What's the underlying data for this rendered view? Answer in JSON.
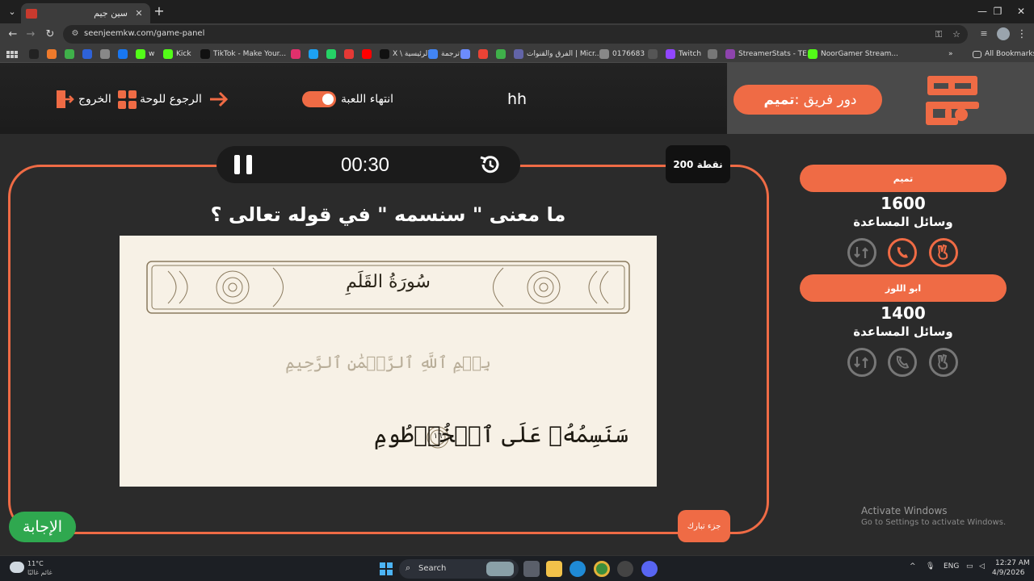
{
  "browser": {
    "tab_title": "سين جيم",
    "tab_close": "✕",
    "new_tab": "+",
    "url": "seenjeemkw.com/game-panel",
    "window_controls": [
      "—",
      "❐",
      "✕"
    ],
    "bookmarks": [
      {
        "label": "",
        "color": "#222"
      },
      {
        "label": "",
        "color": "#ef7a2b"
      },
      {
        "label": "",
        "color": "#3fb04a"
      },
      {
        "label": "",
        "color": "#2e62d8"
      },
      {
        "label": "",
        "color": "#888"
      },
      {
        "label": "",
        "color": "#1877f2"
      },
      {
        "label": "w",
        "color": "#53fc18"
      },
      {
        "label": "Kick",
        "color": "#53fc18"
      },
      {
        "label": "TikTok - Make Your...",
        "color": "#111"
      },
      {
        "label": "",
        "color": "#e1306c"
      },
      {
        "label": "",
        "color": "#1da1f2"
      },
      {
        "label": "",
        "color": "#25d366"
      },
      {
        "label": "",
        "color": "#e53935"
      },
      {
        "label": "",
        "color": "#ff0000"
      },
      {
        "label": "X \\ الرئيسية",
        "color": "#111"
      },
      {
        "label": "ترجمة",
        "color": "#4285f4"
      },
      {
        "label": "",
        "color": "#6c8cff"
      },
      {
        "label": "",
        "color": "#ea4335"
      },
      {
        "label": "",
        "color": "#3fb04a"
      },
      {
        "label": "الفرق والقنوات | Micr...",
        "color": "#6264a7"
      },
      {
        "label": "0176683",
        "color": "#888"
      },
      {
        "label": "",
        "color": "#555"
      },
      {
        "label": "Twitch",
        "color": "#9146ff"
      },
      {
        "label": "",
        "color": "#777"
      },
      {
        "label": "StreamerStats - TE...",
        "color": "#8e44ad"
      },
      {
        "label": "NoorGamer Stream...",
        "color": "#53fc18"
      }
    ],
    "all_bookmarks": "All Bookmarks",
    "chevron": "»"
  },
  "header": {
    "turn_label": "دور فريق :",
    "turn_team": "تميم",
    "game_name": "hh",
    "end_game": "انتهاء اللعبة",
    "back_to_board": "الرجوع للوحة",
    "exit": "الخروج"
  },
  "board": {
    "timer": "00:30",
    "points": "200 نقطة",
    "question": "ما معنى \" سنسمه \" في قوله تعالى ؟",
    "surah_title": "سُورَةُ القَلَمِ",
    "basmala": "بِسۡمِ ٱللَّهِ ٱلرَّحۡمَٰنِ ٱلرَّحِيمِ",
    "verse": "سَنَسِمُهُۥ عَلَى ٱلۡخُرۡطُومِ",
    "verse_number": "١٦",
    "category": "جزء تبارك",
    "answer_button": "الإجابة"
  },
  "teams": [
    {
      "name": "تميم",
      "score": "1600",
      "helpers_label": "وسائل المساعدة",
      "active": true
    },
    {
      "name": "ابو اللوز",
      "score": "1400",
      "helpers_label": "وسائل المساعدة",
      "active": false
    }
  ],
  "watermark": {
    "title": "Activate Windows",
    "subtitle": "Go to Settings to activate Windows."
  },
  "taskbar": {
    "temp": "11°C",
    "weather": "غائم غالبًا",
    "search": "Search",
    "lang": "ENG",
    "time": "12:27 AM",
    "date": "4/9/2026",
    "tray_up": "^"
  },
  "colors": {
    "accent": "#ef6b45",
    "answer": "#2fa84f",
    "background": "#2b2b2b"
  }
}
